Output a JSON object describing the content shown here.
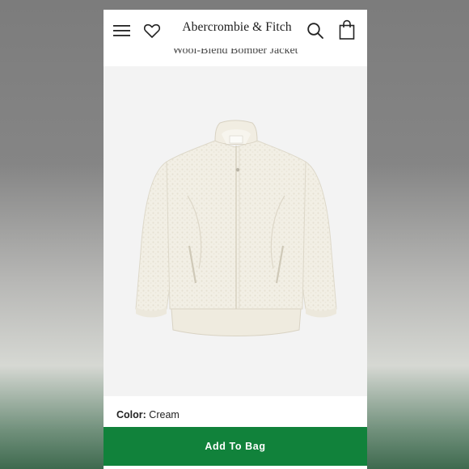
{
  "header": {
    "brand": "Abercrombie & Fitch",
    "icons": [
      "menu-icon",
      "heart-icon",
      "search-icon",
      "shopping-bag-icon"
    ]
  },
  "product": {
    "title": "Wool-Blend Bomber Jacket",
    "image_alt": "Cream wool-blend bomber jacket",
    "color_label": "Color:",
    "color_value": "Cream"
  },
  "actions": {
    "add_to_bag": "Add To Bag"
  },
  "colors": {
    "accent": "#11823b",
    "jacket": "#f1eee4",
    "image_bg": "#f3f3f3"
  }
}
